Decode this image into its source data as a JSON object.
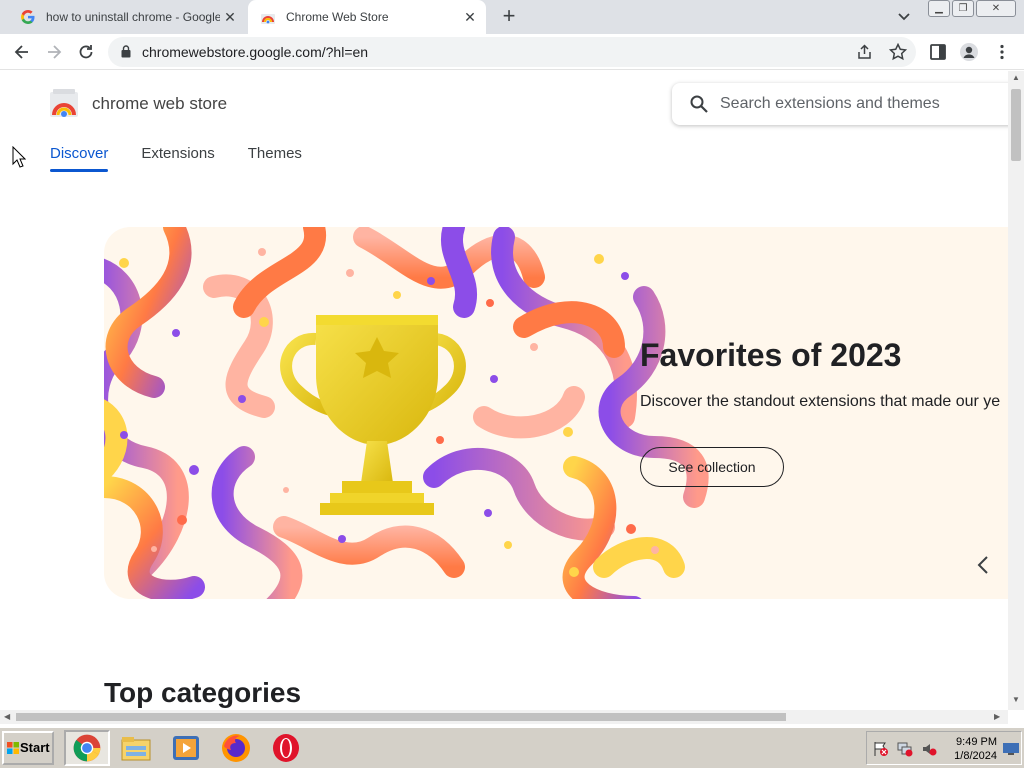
{
  "browser": {
    "tabs": [
      {
        "title": "how to uninstall chrome - Google Se",
        "favicon": "google-g-icon"
      },
      {
        "title": "Chrome Web Store",
        "favicon": "chrome-web-store-icon"
      }
    ],
    "url": "chromewebstore.google.com/?hl=en"
  },
  "store": {
    "brand": "chrome web store",
    "search_placeholder": "Search extensions and themes",
    "nav": [
      "Discover",
      "Extensions",
      "Themes"
    ],
    "active_nav": "Discover"
  },
  "hero": {
    "title": "Favorites of 2023",
    "subtitle": "Discover the standout extensions that made our ye",
    "button": "See collection"
  },
  "section_title": "Top categories",
  "taskbar": {
    "start": "Start",
    "apps": [
      "chrome-icon",
      "file-explorer-icon",
      "media-player-icon",
      "firefox-icon",
      "opera-icon"
    ],
    "time": "9:49 PM",
    "date": "1/8/2024"
  },
  "colors": {
    "accent": "#0b57d0",
    "hero_bg": "#fff7ec",
    "trophy": "#e8c81a",
    "ribbon_purple": "#8c4de8",
    "ribbon_orange": "#ff7a45",
    "ribbon_yellow": "#ffd54a"
  }
}
